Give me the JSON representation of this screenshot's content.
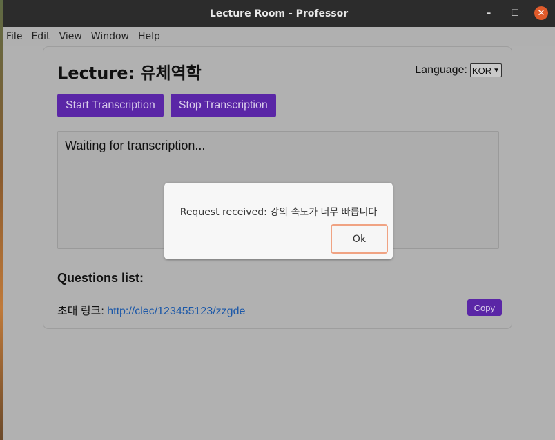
{
  "window": {
    "title": "Lecture Room - Professor",
    "controls": {
      "minimize": "–",
      "maximize": "☐",
      "close": "✕"
    }
  },
  "menubar": {
    "items": [
      {
        "label": "File"
      },
      {
        "label": "Edit"
      },
      {
        "label": "View"
      },
      {
        "label": "Window"
      },
      {
        "label": "Help"
      }
    ]
  },
  "lecture": {
    "title": "Lecture: 유체역학",
    "language_label": "Language:",
    "language_value": "KOR",
    "start_button": "Start Transcription",
    "stop_button": "Stop Transcription",
    "transcript_text": "Waiting for transcription...",
    "questions_title": "Questions list:",
    "invite_label": "초대 링크: ",
    "invite_link": "http://clec/123455123/zzgde",
    "copy_button": "Copy"
  },
  "dialog": {
    "message": "Request received: 강의 속도가 너무 빠릅니다",
    "ok_button": "Ok"
  },
  "colors": {
    "accent_purple": "#5a26a6",
    "link_blue": "#1c58a8",
    "close_orange": "#e05b2b",
    "focus_ring": "#f0a383"
  }
}
